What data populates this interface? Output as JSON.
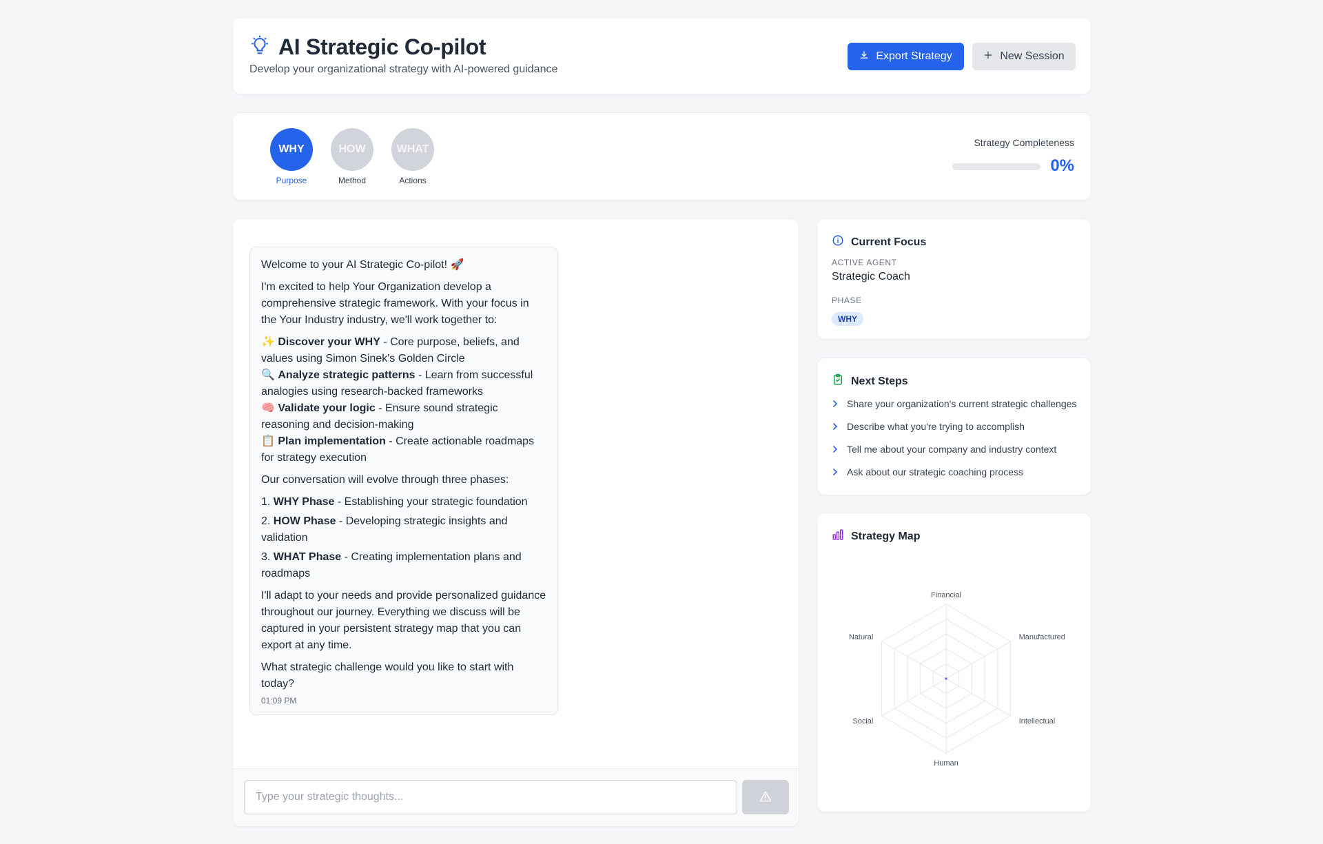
{
  "header": {
    "title": "AI Strategic Co-pilot",
    "subtitle": "Develop your organizational strategy with AI-powered guidance",
    "export_label": "Export Strategy",
    "new_session_label": "New Session"
  },
  "phases": {
    "items": [
      {
        "code": "WHY",
        "label": "Purpose",
        "active": true
      },
      {
        "code": "HOW",
        "label": "Method",
        "active": false
      },
      {
        "code": "WHAT",
        "label": "Actions",
        "active": false
      }
    ],
    "completeness_label": "Strategy Completeness",
    "completeness_value": "0%",
    "completeness_fraction": 0
  },
  "chat": {
    "message": {
      "intro": "Welcome to your AI Strategic Co-pilot! 🚀",
      "para1": "I'm excited to help Your Organization develop a comprehensive strategic framework. With your focus in the Your Industry industry, we'll work together to:",
      "bullets": [
        {
          "emoji": "✨",
          "bold": "Discover your WHY",
          "text": " - Core purpose, beliefs, and values using Simon Sinek's Golden Circle"
        },
        {
          "emoji": "🔍",
          "bold": "Analyze strategic patterns",
          "text": " - Learn from successful analogies using research-backed frameworks"
        },
        {
          "emoji": "🧠",
          "bold": "Validate your logic",
          "text": " - Ensure sound strategic reasoning and decision-making"
        },
        {
          "emoji": "📋",
          "bold": "Plan implementation",
          "text": " - Create actionable roadmaps for strategy execution"
        }
      ],
      "para2": "Our conversation will evolve through three phases:",
      "numbered": [
        {
          "num": "1.",
          "bold": "WHY Phase",
          "text": " - Establishing your strategic foundation"
        },
        {
          "num": "2.",
          "bold": "HOW Phase",
          "text": " - Developing strategic insights and validation"
        },
        {
          "num": "3.",
          "bold": "WHAT Phase",
          "text": " - Creating implementation plans and roadmaps"
        }
      ],
      "para3": "I'll adapt to your needs and provide personalized guidance throughout our journey. Everything we discuss will be captured in your persistent strategy map that you can export at any time.",
      "para4": "What strategic challenge would you like to start with today?",
      "time": "01:09 PM"
    },
    "input_placeholder": "Type your strategic thoughts..."
  },
  "focus": {
    "title": "Current Focus",
    "agent_label": "ACTIVE AGENT",
    "agent_value": "Strategic Coach",
    "phase_label": "PHASE",
    "phase_value": "WHY"
  },
  "next_steps": {
    "title": "Next Steps",
    "items": [
      "Share your organization's current strategic challenges",
      "Describe what you're trying to accomplish",
      "Tell me about your company and industry context",
      "Ask about our strategic coaching process"
    ]
  },
  "strategy_map": {
    "title": "Strategy Map",
    "axes": [
      "Financial",
      "Manufactured",
      "Intellectual",
      "Human",
      "Social",
      "Natural"
    ],
    "values": [
      0,
      0,
      0,
      0,
      0,
      0
    ]
  },
  "colors": {
    "accent": "#2563eb",
    "inactive_phase": "#d1d5db",
    "next_steps_icon": "#16a34a",
    "map_icon": "#9333ea"
  }
}
